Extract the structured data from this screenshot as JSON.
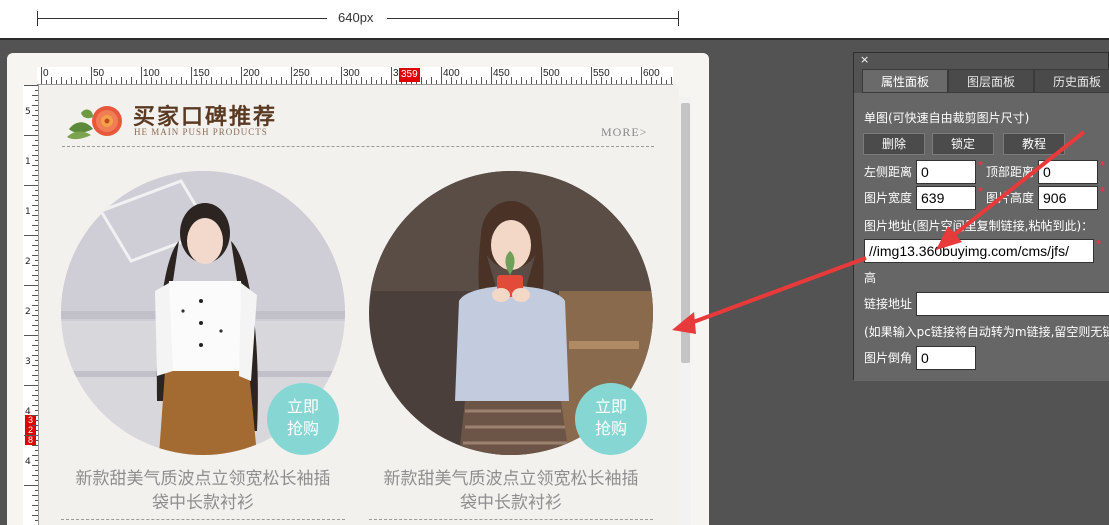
{
  "width_indicator": {
    "label": "640px"
  },
  "ruler": {
    "labels": [
      "0",
      "50",
      "100",
      "150",
      "200",
      "250",
      "300",
      "35",
      "400",
      "450",
      "500",
      "550",
      "600"
    ],
    "position_marker": "359",
    "vertical_marker": "328",
    "vertical_labels": [
      "5",
      "1",
      "1",
      "2",
      "2",
      "3",
      "4",
      "4"
    ]
  },
  "section": {
    "title": "买家口碑推荐",
    "subtitle": "HE MAIN PUSH PRODUCTS",
    "more_label": "MORE>"
  },
  "products": [
    {
      "name_line1": "新款甜美气质波点立领宽松长袖插",
      "name_line2": "袋中长款衬衫",
      "badge_line1": "立即",
      "badge_line2": "抢购"
    },
    {
      "name_line1": "新款甜美气质波点立领宽松长袖插",
      "name_line2": "袋中长款衬衫",
      "badge_line1": "立即",
      "badge_line2": "抢购"
    }
  ],
  "panel": {
    "close": "×",
    "tabs": [
      "属性面板",
      "图层面板",
      "历史面板"
    ],
    "heading": "单图(可快速自由裁剪图片尺寸)",
    "buttons": [
      "删除",
      "锁定",
      "教程"
    ],
    "left_label": "左侧距离",
    "left_value": "0",
    "top_label": "顶部距离",
    "top_value": "0",
    "width_label": "图片宽度",
    "width_value": "639",
    "height_label": "图片高度",
    "height_value": "906",
    "url_label": "图片地址(图片空间里复制链接,粘帖到此)：",
    "url_value": "//img13.360buyimg.com/cms/jfs/",
    "height_short": "高",
    "link_label": "链接地址",
    "link_value": "",
    "link_note": "(如果输入pc链接将自动转为m链接,留空则无链",
    "radius_label": "图片倒角",
    "radius_value": "0"
  },
  "colors": {
    "workspace": "#535353",
    "panel": "#666666",
    "badge": "#86d7d4",
    "title": "#5a3a22",
    "arrow": "#e83a3a"
  }
}
